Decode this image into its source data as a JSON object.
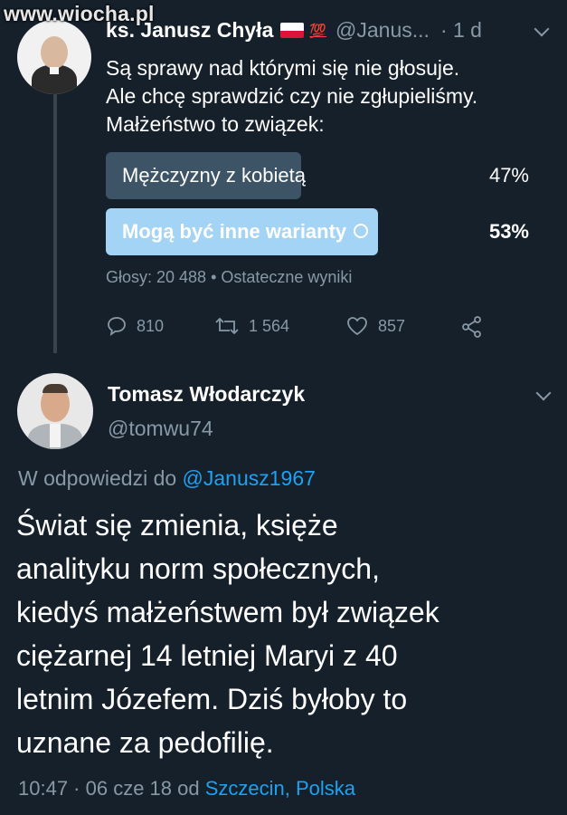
{
  "watermark": "www.wiocha.pl",
  "tweet1": {
    "author_name": "ks. Janusz Chyła",
    "handle": "@Janus...",
    "time": "· 1 d",
    "hundred": "💯",
    "text_lines": [
      "Są sprawy nad którymi się nie głosuje.",
      "Ale chcę sprawdzić czy nie zgłupieliśmy.",
      "Małżeństwo to związek:"
    ],
    "poll": {
      "options": [
        {
          "label": "Mężczyzny z kobietą",
          "percent": "47%",
          "value": 47
        },
        {
          "label": "Mogą być inne warianty",
          "percent": "53%",
          "value": 53,
          "selected": true
        }
      ],
      "meta": "Głosy: 20 488 • Ostateczne wyniki"
    },
    "actions": {
      "replies": "810",
      "retweets": "1 564",
      "likes": "857"
    }
  },
  "tweet2": {
    "author_name": "Tomasz Włodarczyk",
    "handle": "@tomwu74",
    "reply_prefix": "W odpowiedzi do",
    "reply_to": "@Janusz1967",
    "text_lines": [
      "Świat się zmienia, księże",
      "analityku norm społecznych,",
      "kiedyś małżeństwem był związek",
      "ciężarnej 14 letniej Maryi z 40",
      "letnim Józefem. Dziś byłoby to",
      "uznane za pedofilię."
    ],
    "footer_time": "10:47 · 06 cze 18 od",
    "footer_location": "Szczecin, Polska"
  },
  "colors": {
    "background": "#15202b",
    "accent": "#1da1f2",
    "muted": "#8899a6",
    "poll_winner": "#a3d4f5",
    "poll_loser": "#3d5466"
  }
}
